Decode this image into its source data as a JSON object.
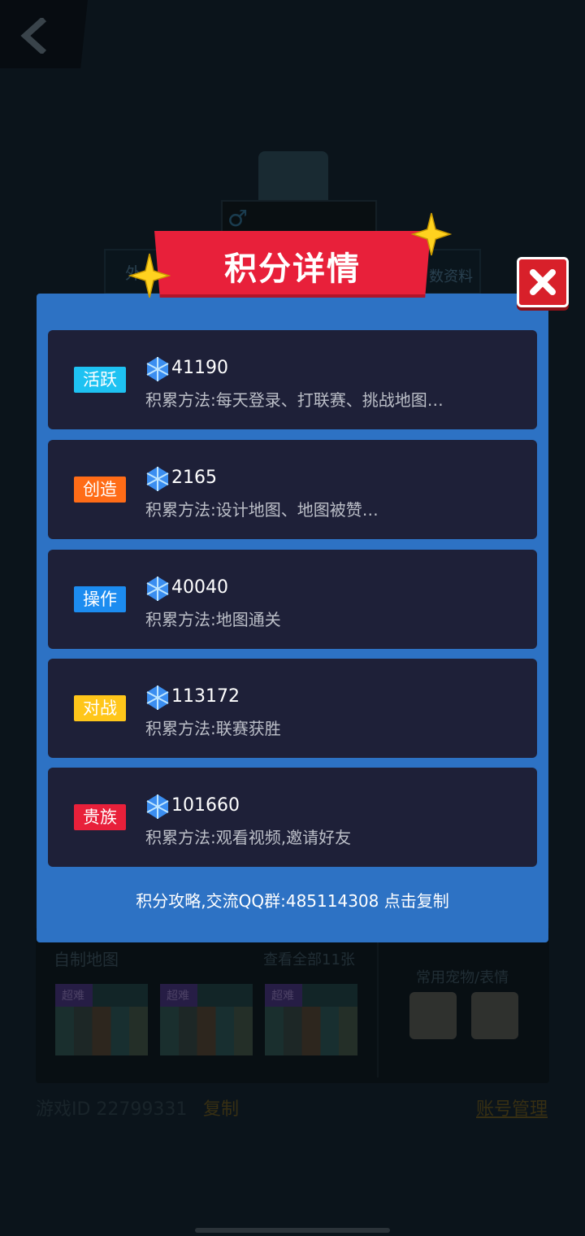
{
  "background": {
    "tab_left_label": "外",
    "tab_right_label": "数资料",
    "own_maps_title": "自制地图",
    "view_all_label": "查看全部11张",
    "map_badges": [
      "超难",
      "超难",
      "超难"
    ],
    "pets_title": "常用宠物/表情",
    "game_id_text": "游戏ID 22799331",
    "copy_label": "复制",
    "account_mgmt_label": "账号管理"
  },
  "modal": {
    "title": "积分详情",
    "cards": [
      {
        "tag": "活跃",
        "tag_color": "#1ec2f2",
        "score": "41190",
        "method": "积累方法:每天登录、打联赛、挑战地图…"
      },
      {
        "tag": "创造",
        "tag_color": "#ff6c17",
        "score": "2165",
        "method": "积累方法:设计地图、地图被赞…"
      },
      {
        "tag": "操作",
        "tag_color": "#1c8cf0",
        "score": "40040",
        "method": "积累方法:地图通关"
      },
      {
        "tag": "对战",
        "tag_color": "#ffc61a",
        "score": "113172",
        "method": "积累方法:联赛获胜"
      },
      {
        "tag": "贵族",
        "tag_color": "#e8203a",
        "score": "101660",
        "method": "积累方法:观看视频,邀请好友"
      }
    ],
    "footer": "积分攻略,交流QQ群:485114308 点击复制"
  },
  "colors": {
    "modal_bg": "#2d72c4",
    "card_bg": "#1e2038",
    "banner_red": "#e8203a",
    "close_red": "#d8202a",
    "star_yellow": "#ffd21f"
  }
}
